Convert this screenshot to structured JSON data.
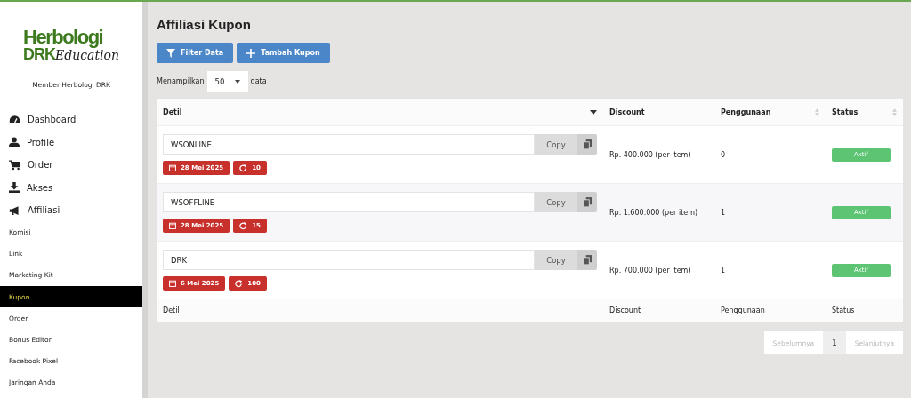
{
  "logo": {
    "line_1": "Herbologi",
    "line_2": "DRK",
    "script": "Education"
  },
  "member_label": "Member Herbologi DRK",
  "sidebar": {
    "items": [
      {
        "label": "Dashboard",
        "kind": "main",
        "selected": false
      },
      {
        "label": "Profile",
        "kind": "main",
        "selected": false
      },
      {
        "label": "Order",
        "kind": "main",
        "selected": false
      },
      {
        "label": "Akses",
        "kind": "main",
        "selected": false
      },
      {
        "label": "Affiliasi",
        "kind": "main",
        "selected": false
      },
      {
        "label": "Komisi",
        "kind": "sub",
        "selected": false
      },
      {
        "label": "Link",
        "kind": "sub",
        "selected": false
      },
      {
        "label": "Marketing Kit",
        "kind": "sub",
        "selected": false
      },
      {
        "label": "Kupon",
        "kind": "sub",
        "selected": true
      },
      {
        "label": "Order",
        "kind": "sub",
        "selected": false
      },
      {
        "label": "Bonus Editor",
        "kind": "sub",
        "selected": false
      },
      {
        "label": "Facebook Pixel",
        "kind": "sub",
        "selected": false
      },
      {
        "label": "Jaringan Anda",
        "kind": "sub",
        "selected": false
      }
    ]
  },
  "page_title": "Affiliasi Kupon",
  "actions": [
    {
      "label": "Filter Data"
    },
    {
      "label": "Tambah Kupon"
    }
  ],
  "page_length": {
    "prefix": "Menampilkan",
    "value": "50",
    "suffix": "data"
  },
  "table": {
    "columns": [
      {
        "label": "Detil",
        "kind": "sorted"
      },
      {
        "label": "Discount",
        "kind": "plain"
      },
      {
        "label": "Penggunaan",
        "kind": "sortable"
      },
      {
        "label": "Status",
        "kind": "sortable"
      }
    ],
    "rows": [
      {
        "code": "WSONLINE",
        "copy_label": "Copy",
        "date": "28 Mei 2025",
        "limit": "10",
        "discount": "Rp. 400.000 (per item)",
        "usage": "0",
        "status": "Aktif"
      },
      {
        "code": "WSOFFLINE",
        "copy_label": "Copy",
        "date": "28 Mei 2025",
        "limit": "15",
        "discount": "Rp. 1.600.000 (per item)",
        "usage": "1",
        "status": "Aktif"
      },
      {
        "code": "DRK",
        "copy_label": "Copy",
        "date": "6 Mei 2025",
        "limit": "100",
        "discount": "Rp. 700.000 (per item)",
        "usage": "1",
        "status": "Aktif"
      }
    ],
    "footer": [
      "Detil",
      "Discount",
      "Penggunaan",
      "Status"
    ]
  },
  "pagination": [
    {
      "label": "Sebelumnya",
      "selected": false
    },
    {
      "label": "1",
      "selected": true
    },
    {
      "label": "Selanjutnya",
      "selected": false
    }
  ]
}
